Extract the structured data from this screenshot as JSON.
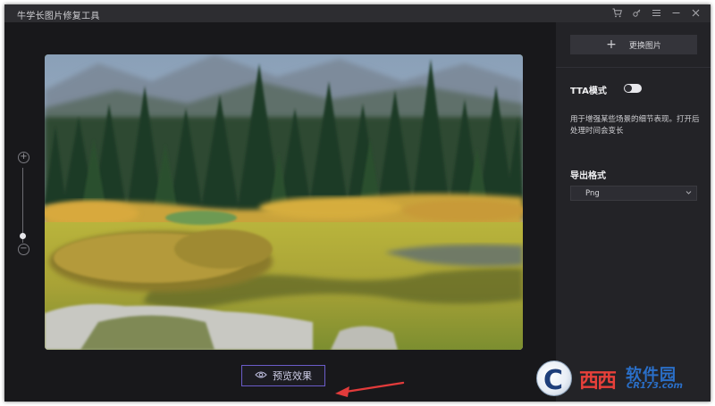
{
  "window": {
    "title": "牛学长图片修复工具"
  },
  "titlebar": {
    "icons": [
      "cart-icon",
      "key-icon",
      "menu-icon",
      "minimize-icon",
      "close-icon"
    ]
  },
  "canvas": {
    "preview_label": "预览效果",
    "zoom_in_symbol": "+",
    "zoom_out_symbol": "−"
  },
  "panel": {
    "change_image_label": "更换图片",
    "change_image_symbol": "+",
    "tta_label": "TTA模式",
    "tta_enabled": false,
    "tta_description": "用于增强某些场景的细节表现。打开后处理时间会变长",
    "export_label": "导出格式",
    "export_format": "Png"
  },
  "watermark": {
    "logo_letter": "C",
    "brand_red": "西西",
    "brand_blue": "软件园",
    "url": "CR173.com"
  },
  "colors": {
    "accent": "#6b5cc9",
    "arrow": "#e23b3b",
    "background": "#1b1b1e",
    "panel": "#232327"
  }
}
